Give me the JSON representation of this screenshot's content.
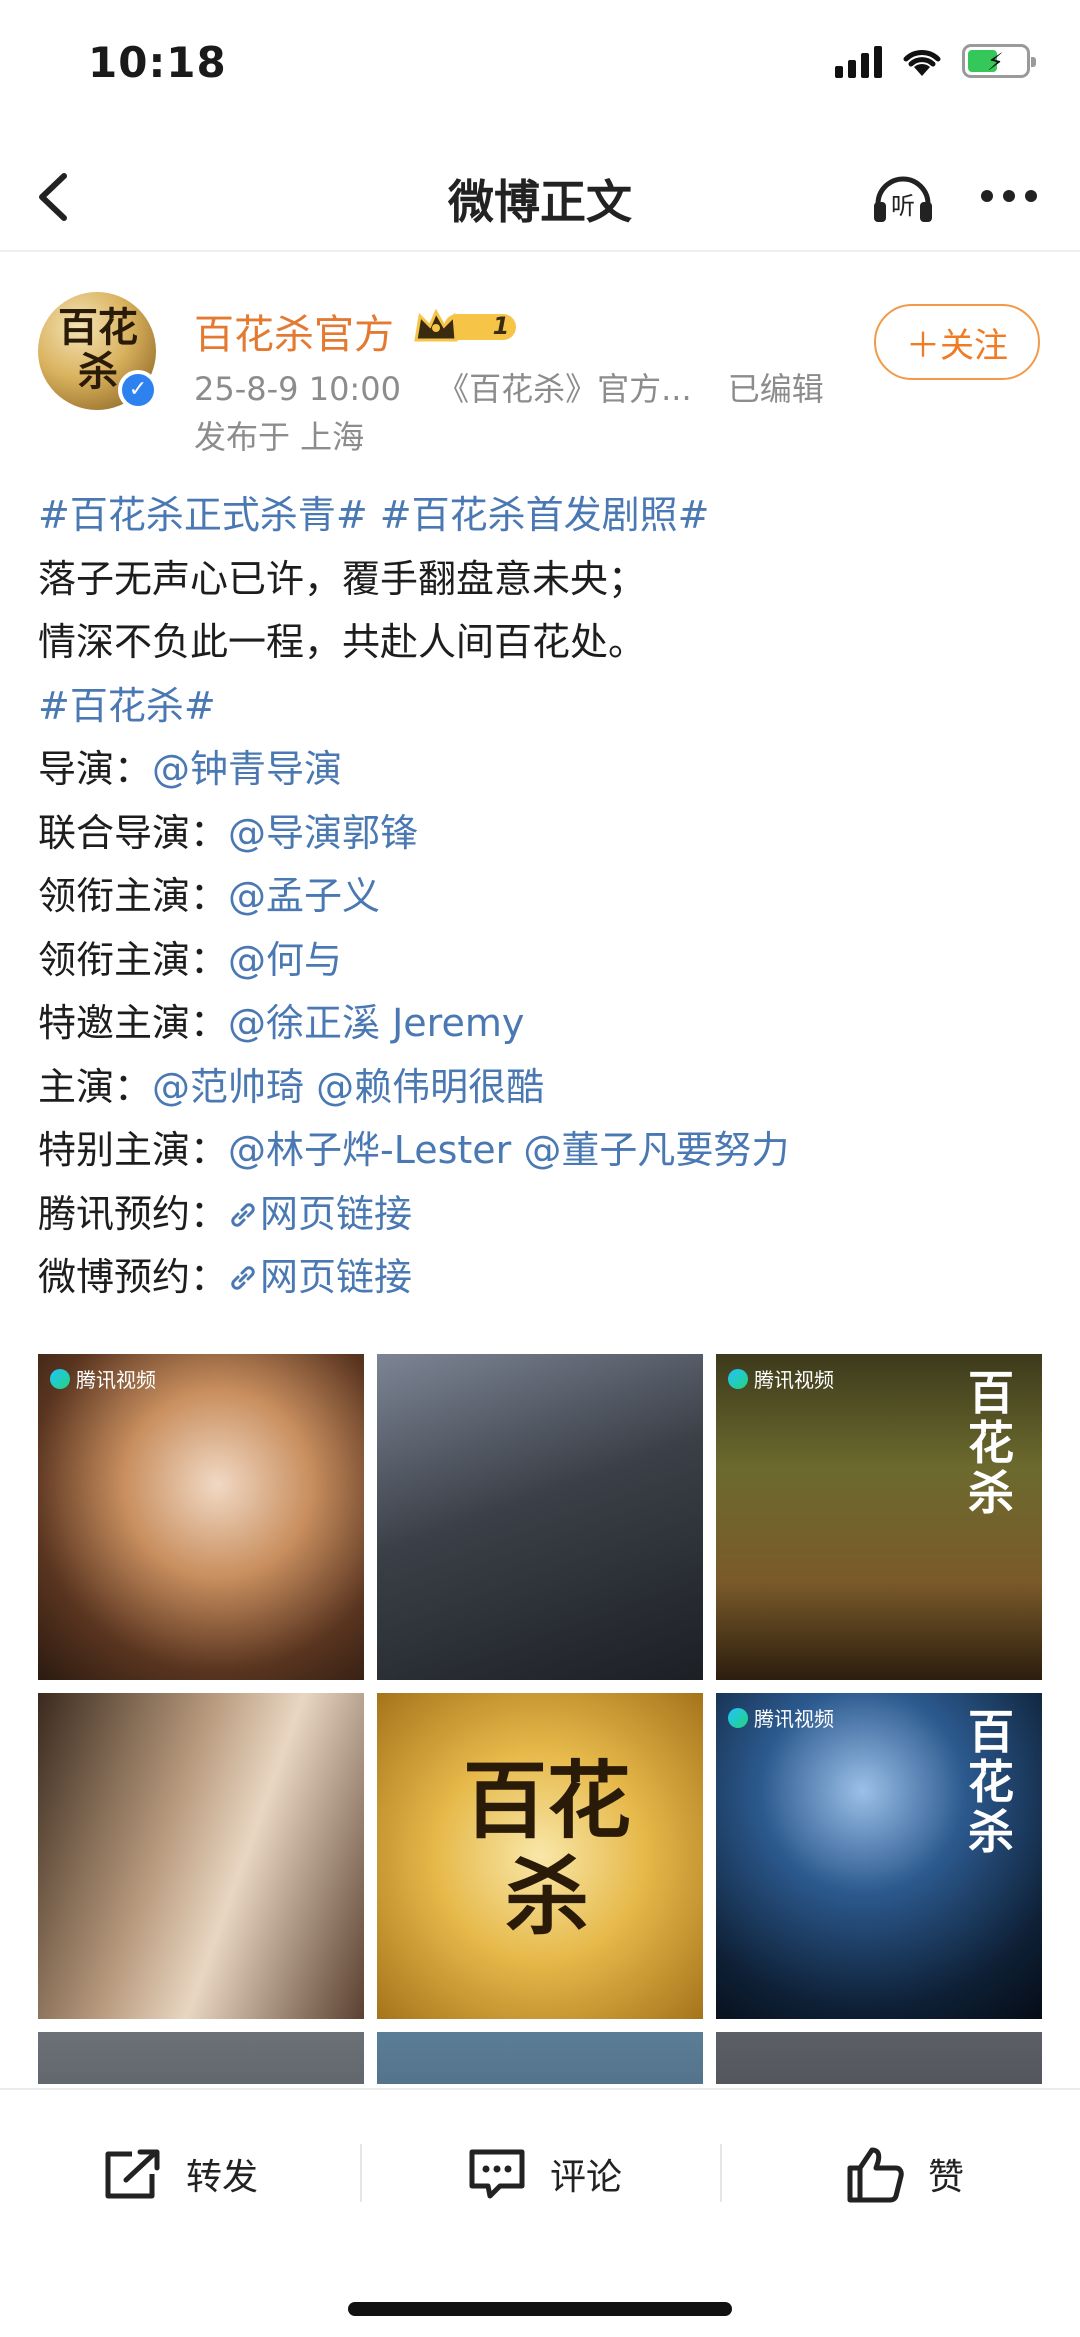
{
  "status_bar": {
    "time": "10:18"
  },
  "nav": {
    "title": "微博正文"
  },
  "author": {
    "name": "百花杀官方",
    "vip_level": "1",
    "date": "25-8-9 10:00",
    "source": "《百花杀》官方...",
    "edited": "已编辑",
    "location": "发布于 上海",
    "follow_label": "＋关注",
    "avatar_text": "百花杀"
  },
  "post": {
    "lines": [
      [
        {
          "type": "tag",
          "text": "#百花杀正式杀青#"
        },
        {
          "type": "text",
          "text": " "
        },
        {
          "type": "tag",
          "text": "#百花杀首发剧照#"
        }
      ],
      [
        {
          "type": "text",
          "text": "落子无声心已许，覆手翻盘意未央；"
        }
      ],
      [
        {
          "type": "text",
          "text": "情深不负此一程，共赴人间百花处。"
        }
      ],
      [
        {
          "type": "tag",
          "text": "#百花杀#"
        }
      ],
      [
        {
          "type": "text",
          "text": "导演："
        },
        {
          "type": "mention",
          "text": "@钟青导演"
        }
      ],
      [
        {
          "type": "text",
          "text": "联合导演："
        },
        {
          "type": "mention",
          "text": "@导演郭锋"
        }
      ],
      [
        {
          "type": "text",
          "text": "领衔主演："
        },
        {
          "type": "mention",
          "text": "@孟子义"
        }
      ],
      [
        {
          "type": "text",
          "text": "领衔主演："
        },
        {
          "type": "mention",
          "text": "@何与"
        }
      ],
      [
        {
          "type": "text",
          "text": "特邀主演："
        },
        {
          "type": "mention",
          "text": "@徐正溪 Jeremy"
        }
      ],
      [
        {
          "type": "text",
          "text": "主演："
        },
        {
          "type": "mention",
          "text": "@范帅琦"
        },
        {
          "type": "text",
          "text": " "
        },
        {
          "type": "mention",
          "text": "@赖伟明很酷"
        }
      ],
      [
        {
          "type": "text",
          "text": "特别主演："
        },
        {
          "type": "mention",
          "text": "@林子烨-Lester"
        },
        {
          "type": "text",
          "text": " "
        },
        {
          "type": "mention",
          "text": "@董子凡要努力"
        }
      ],
      [
        {
          "type": "text",
          "text": "腾讯预约："
        },
        {
          "type": "link",
          "text": "网页链接"
        }
      ],
      [
        {
          "type": "text",
          "text": "微博预约："
        },
        {
          "type": "link",
          "text": "网页链接"
        }
      ]
    ]
  },
  "images": {
    "watermark": "腾讯视频",
    "calligraphy": "百花杀"
  },
  "actions": {
    "repost": "转发",
    "comment": "评论",
    "like": "赞"
  }
}
